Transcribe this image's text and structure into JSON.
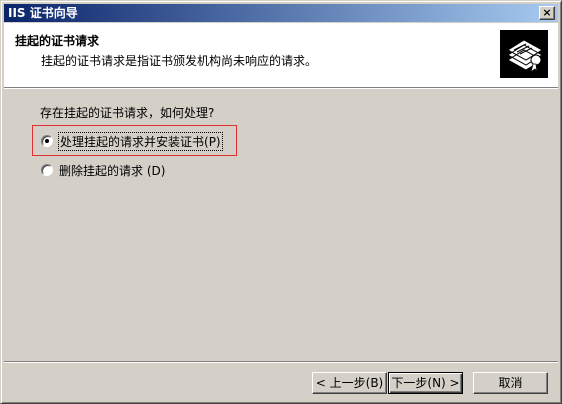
{
  "window": {
    "title": "IIS 证书向导",
    "close_label": "×"
  },
  "header": {
    "title": "挂起的证书请求",
    "subtitle": "挂起的证书请求是指证书颁发机构尚未响应的请求。",
    "icon": "certificate-icon"
  },
  "body": {
    "question": "存在挂起的证书请求，如何处理?",
    "options": [
      {
        "label": "处理挂起的请求并安装证书",
        "hotkey": "(P)",
        "selected": true
      },
      {
        "label": "删除挂起的请求",
        "hotkey": "(D)",
        "selected": false
      }
    ]
  },
  "buttons": {
    "back": "< 上一步(B)",
    "next": "下一步(N) >",
    "cancel": "取消"
  },
  "colors": {
    "highlight_box": "#e03030",
    "title_bar_start": "#0a246a",
    "title_bar_end": "#a6caf0"
  }
}
